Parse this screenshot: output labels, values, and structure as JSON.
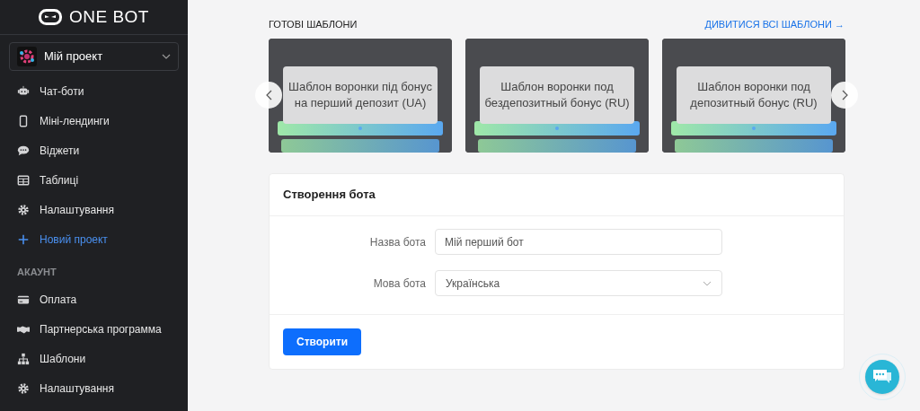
{
  "logo": {
    "text": "ONE BOT"
  },
  "project_selector": {
    "label": "Мій проект"
  },
  "sidebar": {
    "items": [
      {
        "kind": "robot",
        "label": "Чат-боти"
      },
      {
        "kind": "phone",
        "label": "Міні-лендинги"
      },
      {
        "kind": "chat",
        "label": "Віджети"
      },
      {
        "kind": "table",
        "label": "Таблиці"
      },
      {
        "kind": "gear",
        "label": "Налаштування"
      },
      {
        "kind": "plus",
        "label": "Новий проект"
      }
    ],
    "section_heading": "АКАУНТ",
    "account_items": [
      {
        "kind": "card",
        "label": "Оплата"
      },
      {
        "kind": "handshake",
        "label": "Партнерська программа"
      },
      {
        "kind": "sitemap",
        "label": "Шаблони"
      },
      {
        "kind": "gear",
        "label": "Налаштування"
      }
    ]
  },
  "templates": {
    "title": "ГОТОВІ ШАБЛОНИ",
    "view_all": "ДИВИТИСЯ ВСІ ШАБЛОНИ →",
    "cards": [
      {
        "caption": "Шаблон воронки під бонус на перший депозит (UA)"
      },
      {
        "caption": "Шаблон воронки под бездепозитный бонус (RU)"
      },
      {
        "caption": "Шаблон воронки под депозитный бонус (RU)"
      }
    ]
  },
  "create_bot": {
    "title": "Створення бота",
    "fields": [
      {
        "kind": "text",
        "label": "Назва бота",
        "value": "Мій перший бот"
      },
      {
        "kind": "select",
        "label": "Мова бота",
        "value": "Українська"
      }
    ],
    "submit": "Створити"
  }
}
